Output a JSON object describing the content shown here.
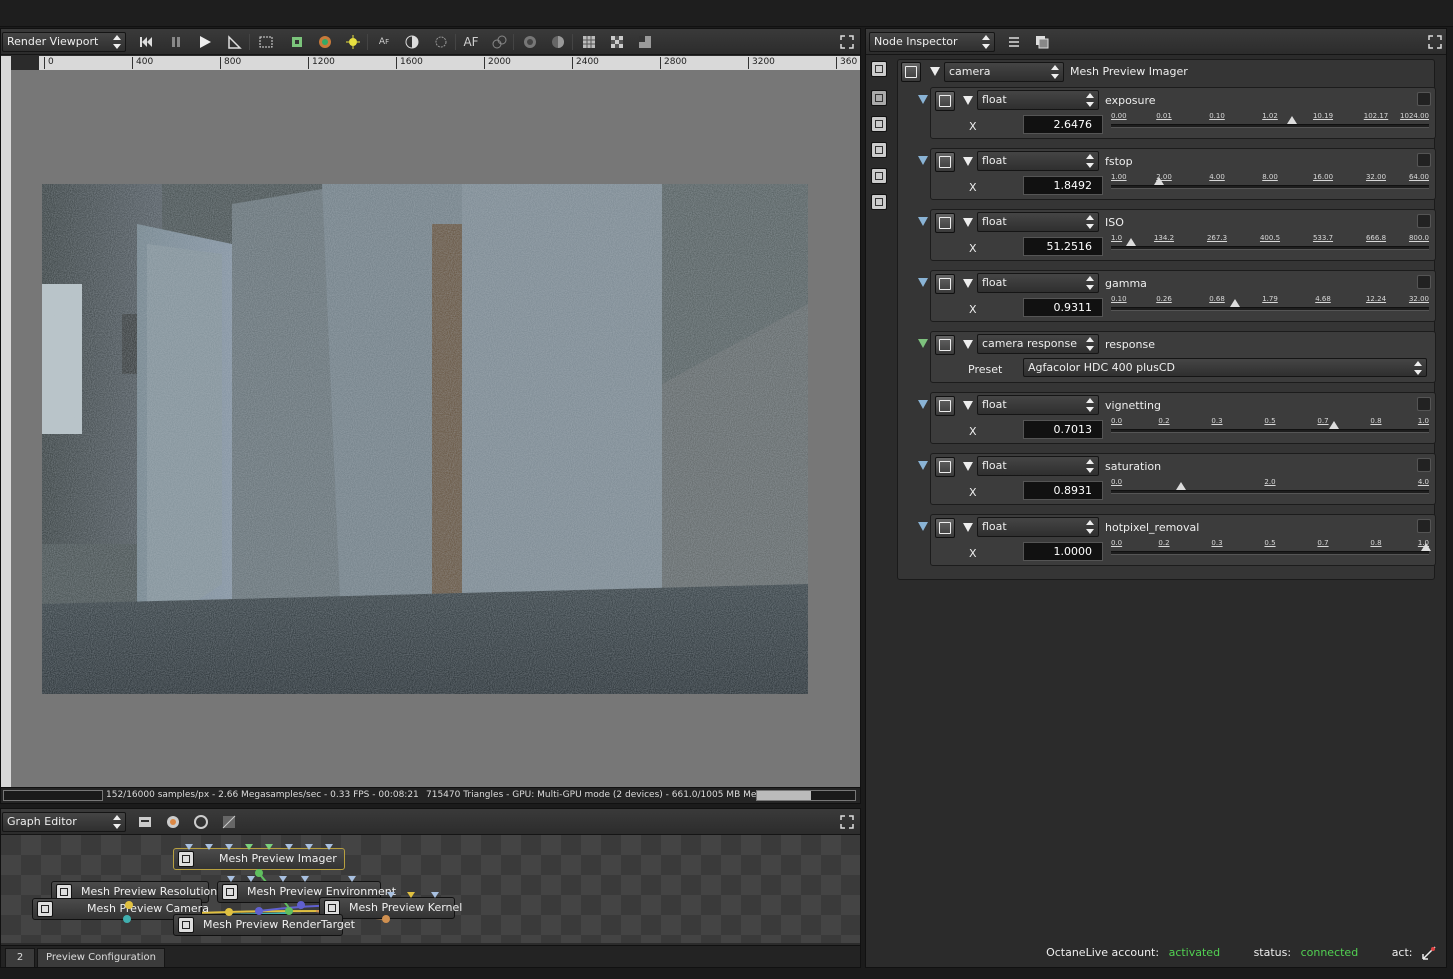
{
  "viewport": {
    "title": "Render Viewport",
    "ruler_ticks": [
      "0",
      "400",
      "800",
      "1200",
      "1600",
      "2000",
      "2400",
      "2800",
      "3200",
      "360"
    ],
    "status_left": "152/16000 samples/px - 2.66 Megasamples/sec - 0.33 FPS - 00:08:21",
    "status_right": "715470 Triangles - GPU: Multi-GPU mode (2 devices) - 661.0/1005 MB Mem Used",
    "progress": 0.55,
    "toolbar_icons": [
      "rewind-icon",
      "pause-icon",
      "play-icon",
      "pick-icon",
      "region-icon",
      "focus-icon",
      "material-icon",
      "light-icon",
      "af-pick-icon",
      "whitebalance-icon",
      "vignette-pick-icon",
      "af-icon",
      "clay-icon",
      "alpha-icon",
      "shadow-icon",
      "grid-icon",
      "checker-icon",
      "lock-icon",
      "maximize-icon"
    ],
    "af_label": "AF"
  },
  "graph_editor": {
    "title": "Graph Editor",
    "nodes": {
      "imager": "Mesh Preview Imager",
      "resolution": "Mesh Preview Resolution",
      "environment": "Mesh Preview Environment",
      "camera": "Mesh Preview Camera",
      "kernel": "Mesh Preview Kernel",
      "rendertarget": "Mesh Preview RenderTarget"
    },
    "tabs": [
      "2",
      "Preview Configuration"
    ]
  },
  "inspector": {
    "title": "Node Inspector",
    "header_dropdown": "camera",
    "header_name": "Mesh Preview Imager",
    "params": [
      {
        "type": "float",
        "name": "exposure",
        "value": "2.6476",
        "ticks": [
          "0.00",
          "0.01",
          "0.10",
          "1.02",
          "10.19",
          "102.17",
          "1024.00"
        ],
        "thumb": 0.57
      },
      {
        "type": "float",
        "name": "fstop",
        "value": "1.8492",
        "ticks": [
          "1.00",
          "2.00",
          "4.00",
          "8.00",
          "16.00",
          "32.00",
          "64.00"
        ],
        "thumb": 0.15
      },
      {
        "type": "float",
        "name": "ISO",
        "value": "51.2516",
        "ticks": [
          "1.0",
          "134.2",
          "267.3",
          "400.5",
          "533.7",
          "666.8",
          "800.0"
        ],
        "thumb": 0.063
      },
      {
        "type": "float",
        "name": "gamma",
        "value": "0.9311",
        "ticks": [
          "0.10",
          "0.26",
          "0.68",
          "1.79",
          "4.68",
          "12.24",
          "32.00"
        ],
        "thumb": 0.39
      },
      {
        "type": "camera response",
        "name": "response",
        "preset_label": "Preset",
        "preset_value": "Agfacolor HDC 400 plusCD"
      },
      {
        "type": "float",
        "name": "vignetting",
        "value": "0.7013",
        "ticks": [
          "0.0",
          "0.2",
          "0.3",
          "0.5",
          "0.7",
          "0.8",
          "1.0"
        ],
        "thumb": 0.7
      },
      {
        "type": "float",
        "name": "saturation",
        "value": "0.8931",
        "ticks": [
          "0.0",
          "2.0",
          "4.0"
        ],
        "thumb": 0.22
      },
      {
        "type": "float",
        "name": "hotpixel_removal",
        "value": "1.0000",
        "ticks": [
          "0.0",
          "0.2",
          "0.3",
          "0.5",
          "0.7",
          "0.8",
          "1.0"
        ],
        "thumb": 1.0
      }
    ],
    "x_label": "X",
    "footer": {
      "account_label": "OctaneLive account:",
      "account_value": "activated",
      "status_label": "status:",
      "status_value": "connected",
      "act_label": "act:"
    }
  },
  "colors": {
    "accent_green": "#52d152",
    "panel": "#2b2b2b",
    "canvas": "#777777"
  }
}
